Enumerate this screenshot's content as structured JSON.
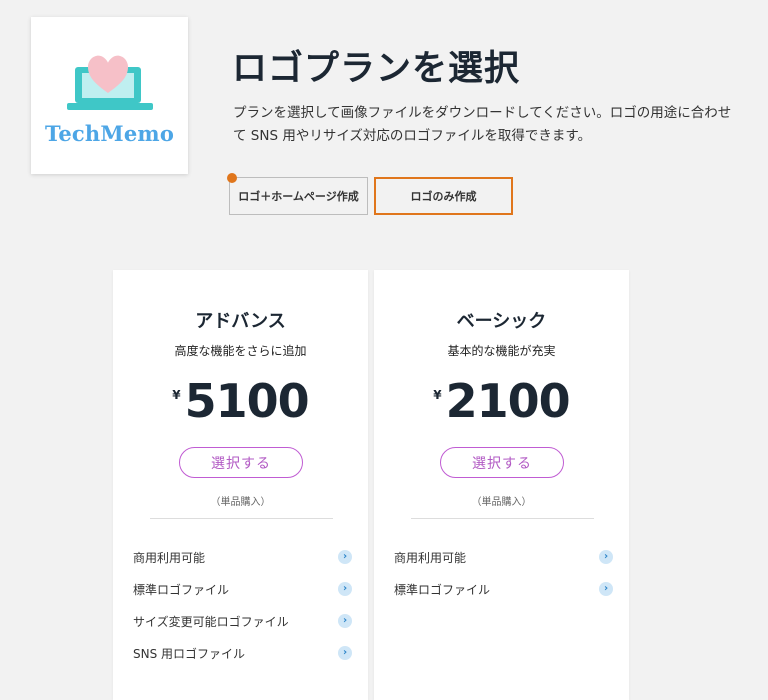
{
  "logo": {
    "text": "TechMemo",
    "icon": "laptop-heart-logo",
    "colors": {
      "text": "#4da6e6",
      "laptop": "#3fc7c7",
      "heart": "#f6c0c8"
    }
  },
  "header": {
    "title": "ロゴプランを選択",
    "description": "プランを選択して画像ファイルをダウンロードしてください。ロゴの用途に合わせて SNS 用やリサイズ対応のロゴファイルを取得できます。"
  },
  "tabs": [
    {
      "label": "ロゴ＋ホームページ作成",
      "selected": false
    },
    {
      "label": "ロゴのみ作成",
      "selected": true
    }
  ],
  "accent_color": "#e0761c",
  "button_color": "#c05cd3",
  "plans": [
    {
      "name": "アドバンス",
      "subtitle": "高度な機能をさらに追加",
      "currency": "¥",
      "price": "5100",
      "button_label": "選択する",
      "note": "（単品購入）",
      "features": [
        "商用利用可能",
        "標準ロゴファイル",
        "サイズ変更可能ロゴファイル",
        "SNS 用ロゴファイル"
      ]
    },
    {
      "name": "ベーシック",
      "subtitle": "基本的な機能が充実",
      "currency": "¥",
      "price": "2100",
      "button_label": "選択する",
      "note": "（単品購入）",
      "features": [
        "商用利用可能",
        "標準ロゴファイル"
      ]
    }
  ]
}
